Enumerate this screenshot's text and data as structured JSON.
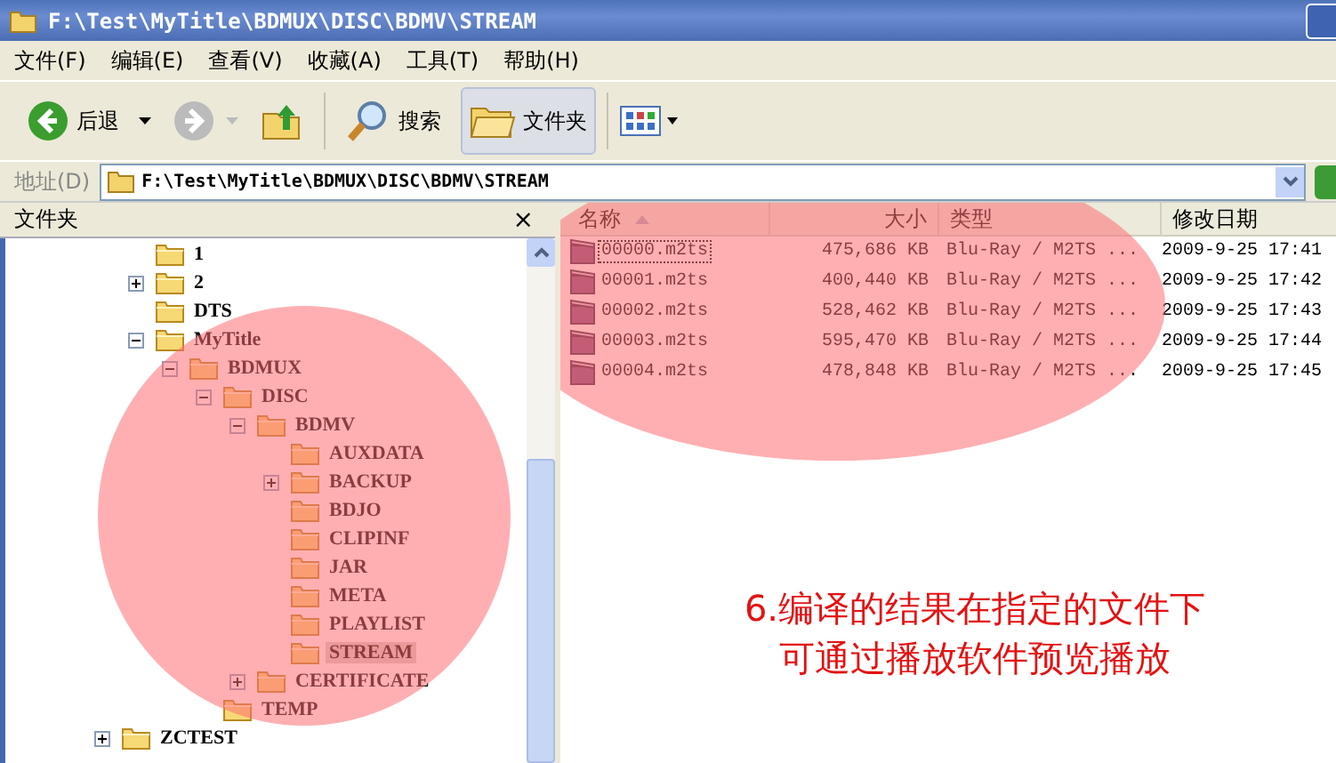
{
  "window": {
    "title": "F:\\Test\\MyTitle\\BDMUX\\DISC\\BDMV\\STREAM"
  },
  "menu": [
    "文件(F)",
    "编辑(E)",
    "查看(V)",
    "收藏(A)",
    "工具(T)",
    "帮助(H)"
  ],
  "toolbar": {
    "back": "后退",
    "search": "搜索",
    "folders": {
      "label": "文件夹",
      "selected": true
    }
  },
  "address": {
    "label": "地址(D)",
    "value": "F:\\Test\\MyTitle\\BDMUX\\DISC\\BDMV\\STREAM"
  },
  "folder_pane": {
    "title": "文件夹",
    "close": "×",
    "items": [
      {
        "children": [
          {
            "label": "1",
            "selected": false
          },
          {
            "label": "2",
            "selected": false,
            "expanded": false
          },
          {
            "label": "DTS",
            "selected": false
          },
          {
            "label": "MyTitle",
            "selected": false,
            "expanded": true,
            "children": [
              {
                "label": "BDMUX",
                "selected": false,
                "expanded": true,
                "children": [
                  {
                    "label": "DISC",
                    "selected": false,
                    "expanded": true,
                    "children": [
                      {
                        "label": "BDMV",
                        "selected": false,
                        "expanded": true,
                        "children": [
                          {
                            "label": "AUXDATA",
                            "selected": false
                          },
                          {
                            "label": "BACKUP",
                            "selected": false,
                            "expanded": false
                          },
                          {
                            "label": "BDJO",
                            "selected": false
                          },
                          {
                            "label": "CLIPINF",
                            "selected": false
                          },
                          {
                            "label": "JAR",
                            "selected": false
                          },
                          {
                            "label": "META",
                            "selected": false
                          },
                          {
                            "label": "PLAYLIST",
                            "selected": false
                          },
                          {
                            "label": "STREAM",
                            "selected": true
                          }
                        ]
                      },
                      {
                        "label": "CERTIFICATE",
                        "selected": false,
                        "expanded": false
                      }
                    ]
                  },
                  {
                    "label": "TEMP",
                    "selected": false
                  }
                ]
              }
            ]
          }
        ]
      },
      {
        "label": "ZCTEST",
        "selected": false,
        "expanded": false
      }
    ]
  },
  "file_list": {
    "columns": [
      "名称",
      "大小",
      "类型",
      "修改日期"
    ],
    "rows": [
      {
        "name": "00000.m2ts",
        "size": "475,686 KB",
        "type": "Blu-Ray / M2TS ...",
        "modified": "2009-9-25 17:41",
        "focused": true
      },
      {
        "name": "00001.m2ts",
        "size": "400,440 KB",
        "type": "Blu-Ray / M2TS ...",
        "modified": "2009-9-25 17:42",
        "focused": false
      },
      {
        "name": "00002.m2ts",
        "size": "528,462 KB",
        "type": "Blu-Ray / M2TS ...",
        "modified": "2009-9-25 17:43",
        "focused": false
      },
      {
        "name": "00003.m2ts",
        "size": "595,470 KB",
        "type": "Blu-Ray / M2TS ...",
        "modified": "2009-9-25 17:44",
        "focused": false
      },
      {
        "name": "00004.m2ts",
        "size": "478,848 KB",
        "type": "Blu-Ray / M2TS ...",
        "modified": "2009-9-25 17:45",
        "focused": false
      }
    ]
  },
  "annotation": [
    "6.编译的结果在指定的文件下",
    "可通过播放软件预览播放"
  ]
}
